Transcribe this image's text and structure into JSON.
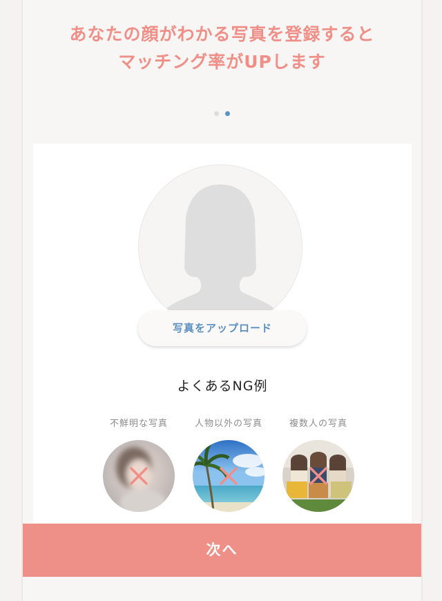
{
  "header": {
    "line1": "あなたの顔がわかる写真を登録すると",
    "line2": "マッチング率がUPします"
  },
  "pager": {
    "total": 2,
    "active_index": 1
  },
  "profile": {
    "avatar_icon": "person-silhouette-icon",
    "upload_label": "写真をアップロード"
  },
  "ng_examples": {
    "title": "よくあるNG例",
    "items": [
      {
        "caption": "不鮮明な写真",
        "icon": "cross-icon"
      },
      {
        "caption": "人物以外の写真",
        "icon": "cross-icon"
      },
      {
        "caption": "複数人の写真",
        "icon": "cross-icon"
      }
    ]
  },
  "footer": {
    "next_label": "次へ"
  },
  "colors": {
    "accent": "#ef9088",
    "headline": "#ef8f87",
    "link_blue": "#5b8fc0",
    "dot_active": "#5b93c8"
  }
}
